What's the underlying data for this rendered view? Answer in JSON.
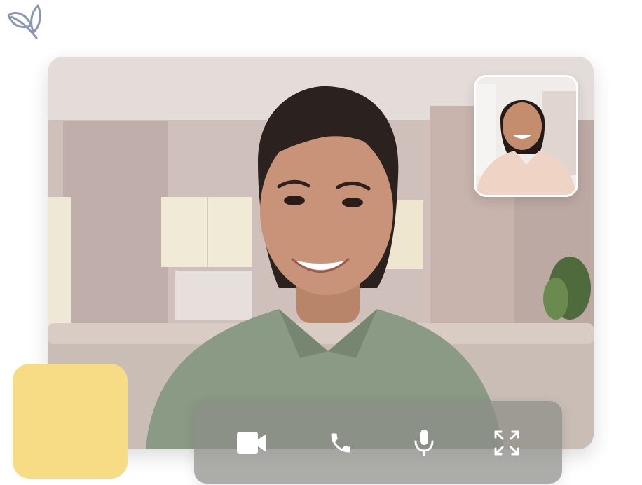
{
  "call": {
    "controls": [
      {
        "id": "video",
        "icon": "video-camera-icon"
      },
      {
        "id": "call",
        "icon": "phone-icon"
      },
      {
        "id": "mic",
        "icon": "microphone-icon"
      },
      {
        "id": "fullscreen",
        "icon": "fullscreen-icon"
      }
    ]
  },
  "colors": {
    "accent_yellow": "#f7dc85",
    "control_bar": "#8c8e86",
    "icon": "#ffffff",
    "logo_stroke": "#8a95b5"
  }
}
